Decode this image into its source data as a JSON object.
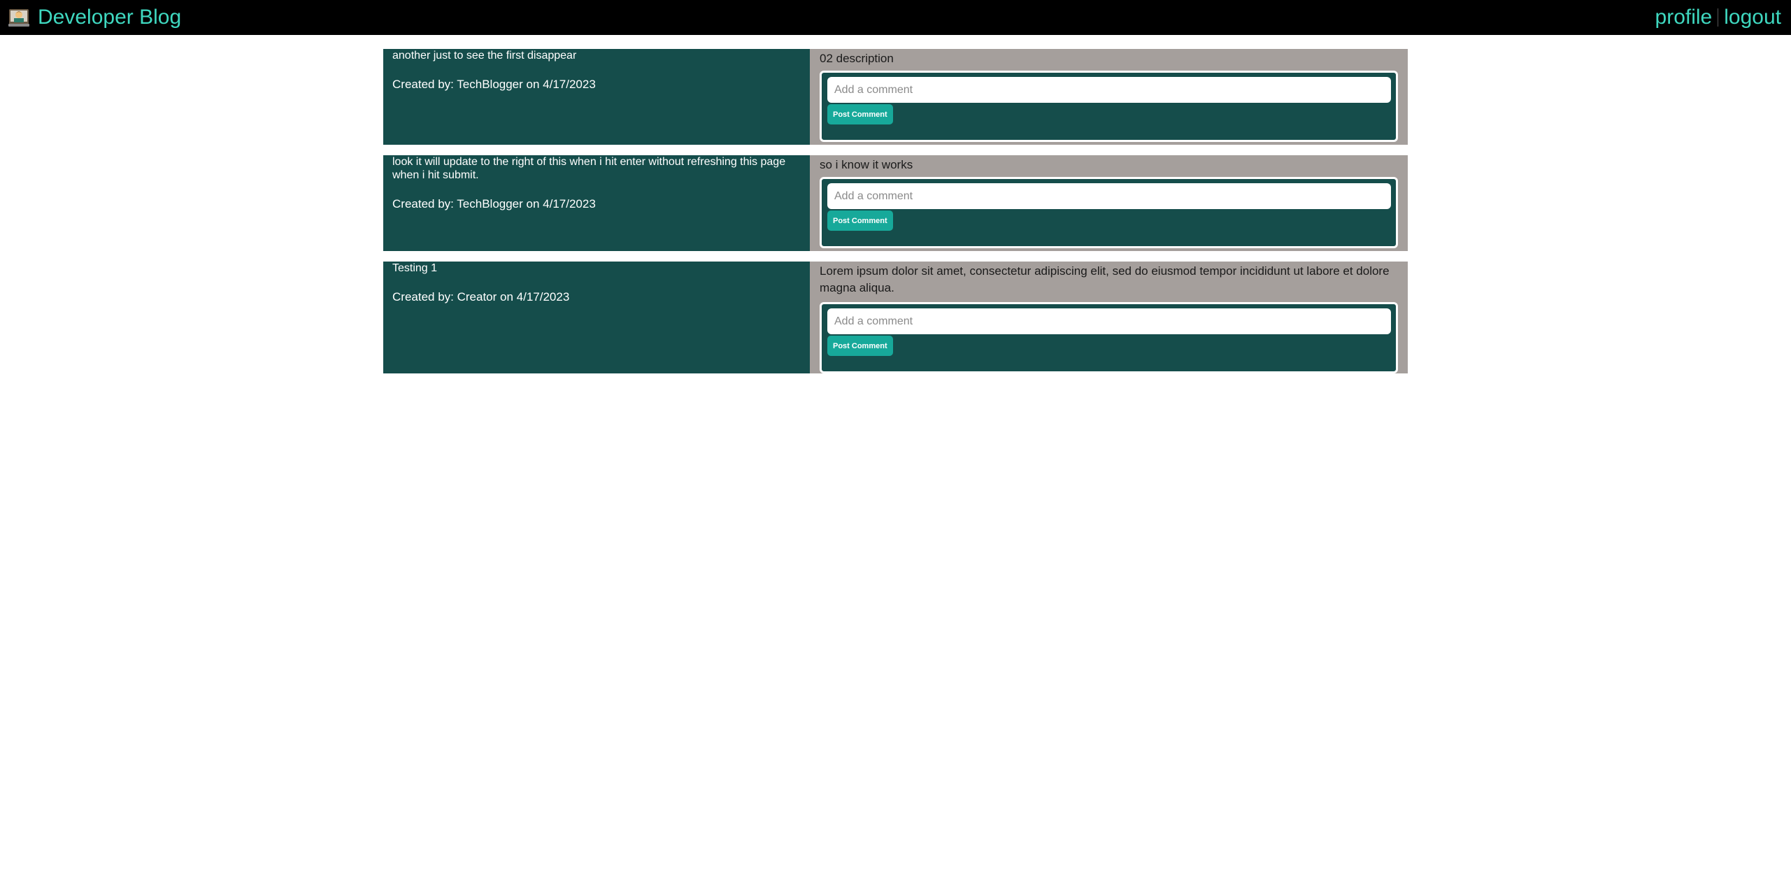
{
  "header": {
    "title": "Developer Blog",
    "logo_icon": "developer-emoji-icon",
    "nav": [
      {
        "label": "profile"
      },
      {
        "label": "logout"
      }
    ],
    "accent_color": "#3fd8c0"
  },
  "posts": [
    {
      "title": "another just to see the first disappear",
      "meta": "Created by: TechBlogger on 4/17/2023",
      "description": "02 description",
      "comment_placeholder": "Add a comment",
      "button_label": "Post Comment"
    },
    {
      "title": "look it will update to the right of this when i hit enter without refreshing this page when i hit submit.",
      "meta": "Created by: TechBlogger on 4/17/2023",
      "description": "so i know it works",
      "comment_placeholder": "Add a comment",
      "button_label": "Post Comment"
    },
    {
      "title": "Testing 1",
      "meta": "Created by: Creator on 4/17/2023",
      "description": "Lorem ipsum dolor sit amet, consectetur adipiscing elit, sed do eiusmod tempor incididunt ut labore et dolore magna aliqua.",
      "comment_placeholder": "Add a comment",
      "button_label": "Post Comment"
    }
  ],
  "colors": {
    "post_left_bg": "#154d4b",
    "post_right_bg": "#a59f9c",
    "button_bg": "#17a99a"
  }
}
